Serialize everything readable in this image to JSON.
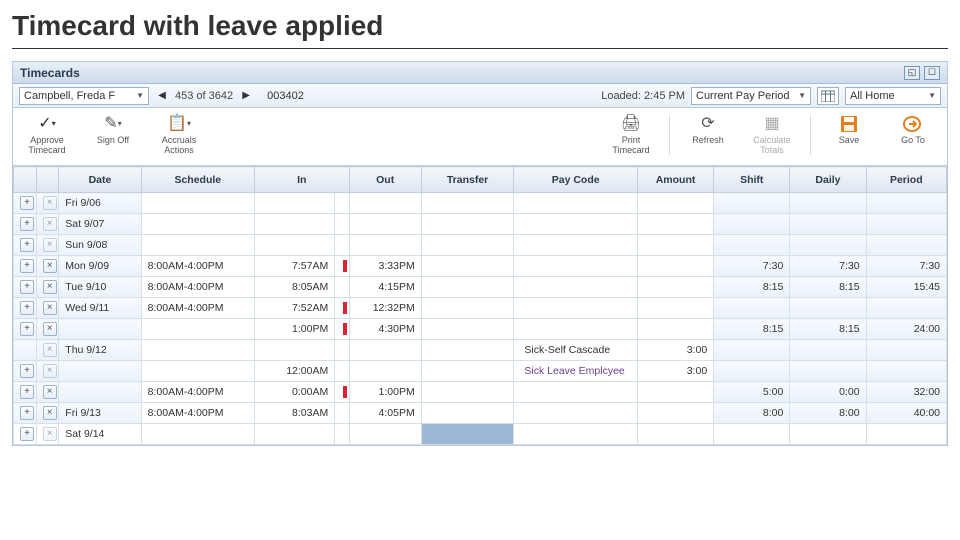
{
  "page": {
    "title": "Timecard with leave applied"
  },
  "header": {
    "title": "Timecards"
  },
  "nav": {
    "employee": "Campbell, Freda F",
    "pager_label": "453 of 3642",
    "employee_id": "003402",
    "loaded_label": "Loaded: 2:45 PM",
    "period": "Current Pay Period",
    "home_filter": "All Home"
  },
  "toolbar": {
    "approve": "Approve Timecard",
    "signoff": "Sign Off",
    "accruals": "Accruals Actions",
    "print": "Print Timecard",
    "refresh": "Refresh",
    "calc": "Calculate Totals",
    "save": "Save",
    "goto": "Go To"
  },
  "columns": {
    "date": "Date",
    "schedule": "Schedule",
    "in": "In",
    "out": "Out",
    "transfer": "Transfer",
    "paycode": "Pay Code",
    "amount": "Amount",
    "shift": "Shift",
    "daily": "Daily",
    "period": "Period"
  },
  "rows": [
    {
      "add": true,
      "del": false,
      "date": "Fri 9/06",
      "schedule": "",
      "in": "",
      "flag": false,
      "out": "",
      "transfer": "",
      "paycode": "",
      "amount": "",
      "shift": "",
      "daily": "",
      "period": ""
    },
    {
      "add": true,
      "del": false,
      "date": "Sat 9/07",
      "schedule": "",
      "in": "",
      "flag": false,
      "out": "",
      "transfer": "",
      "paycode": "",
      "amount": "",
      "shift": "",
      "daily": "",
      "period": ""
    },
    {
      "add": true,
      "del": false,
      "date": "Sun 9/08",
      "schedule": "",
      "in": "",
      "flag": false,
      "out": "",
      "transfer": "",
      "paycode": "",
      "amount": "",
      "shift": "",
      "daily": "",
      "period": ""
    },
    {
      "add": true,
      "del": true,
      "date": "Mon 9/09",
      "schedule": "8:00AM-4:00PM",
      "in": "7:57AM",
      "flag": true,
      "out": "3:33PM",
      "transfer": "",
      "paycode": "",
      "amount": "",
      "shift": "7:30",
      "daily": "7:30",
      "period": "7:30"
    },
    {
      "add": true,
      "del": true,
      "date": "Tue 9/10",
      "schedule": "8:00AM-4:00PM",
      "in": "8:05AM",
      "flag": false,
      "out": "4:15PM",
      "transfer": "",
      "paycode": "",
      "amount": "",
      "shift": "8:15",
      "daily": "8:15",
      "period": "15:45"
    },
    {
      "add": true,
      "del": true,
      "date": "Wed 9/11",
      "schedule": "8:00AM-4:00PM",
      "in": "7:52AM",
      "flag": true,
      "out": "12:32PM",
      "transfer": "",
      "paycode": "",
      "amount": "",
      "shift": "",
      "daily": "",
      "period": ""
    },
    {
      "add": true,
      "del": true,
      "date": "",
      "schedule": "",
      "in": "1:00PM",
      "flag": true,
      "out": "4:30PM",
      "transfer": "",
      "paycode": "",
      "amount": "",
      "shift": "8:15",
      "daily": "8:15",
      "period": "24:00"
    },
    {
      "add": false,
      "del": false,
      "date": "Thu 9/12",
      "schedule": "",
      "in": "",
      "flag": false,
      "out": "",
      "transfer": "",
      "paycode": "Sick-Self Cascade",
      "amount": "3:00",
      "shift": "",
      "daily": "",
      "period": ""
    },
    {
      "add": true,
      "del": false,
      "date": "",
      "schedule": "",
      "in": "12:00AM",
      "flag": false,
      "out": "",
      "transfer": "",
      "paycode": "Sick Leave Emplcyee",
      "paylink": true,
      "amount": "3:00",
      "shift": "",
      "daily": "",
      "period": ""
    },
    {
      "add": true,
      "del": true,
      "date": "",
      "schedule": "8:00AM-4:00PM",
      "in": "0:00AM",
      "flag": true,
      "out": "1:00PM",
      "transfer": "",
      "paycode": "",
      "amount": "",
      "shift": "5:00",
      "daily": "0:00",
      "period": "32:00"
    },
    {
      "add": true,
      "del": true,
      "date": "Fri 9/13",
      "schedule": "8:00AM-4:00PM",
      "in": "8:03AM",
      "flag": false,
      "out": "4:05PM",
      "transfer": "",
      "paycode": "",
      "amount": "",
      "shift": "8:00",
      "daily": "8:00",
      "period": "40:00"
    },
    {
      "add": true,
      "del": false,
      "date": "Sat 9/14",
      "schedule": "",
      "in": "",
      "flag": false,
      "out": "",
      "transfer": "",
      "paycode": "",
      "amount": "",
      "shift": "",
      "daily": "",
      "period": "",
      "hl": true
    }
  ]
}
